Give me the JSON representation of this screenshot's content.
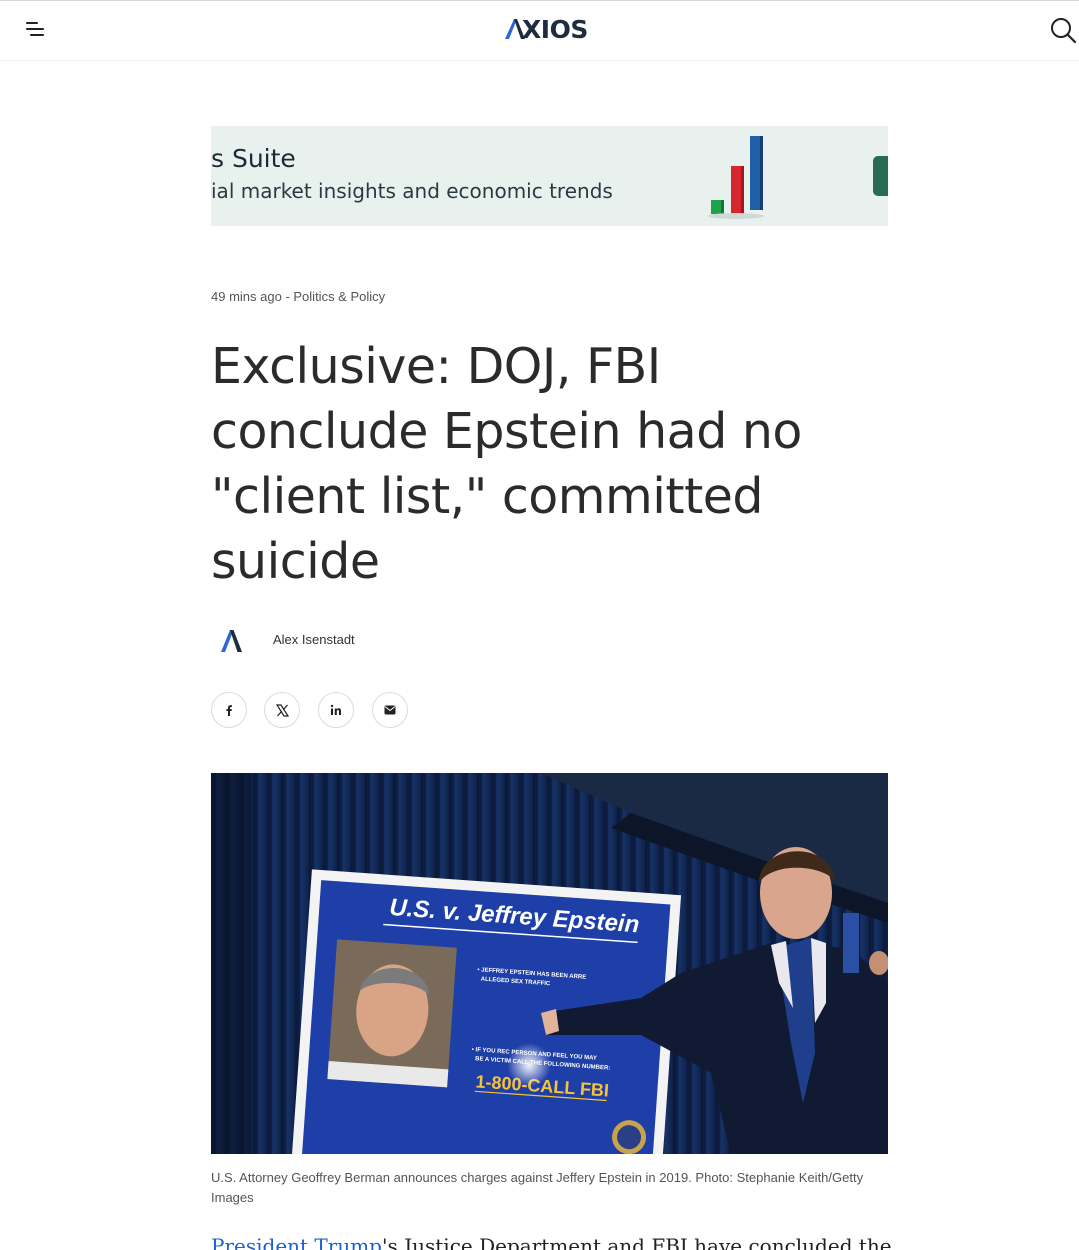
{
  "header": {
    "logo_text": "XIOS",
    "menu_icon": "menu-icon",
    "search_icon": "search-icon"
  },
  "ad": {
    "title": "s Suite",
    "subtitle": "ial market insights and economic trends",
    "colors": {
      "background": "#e9f1ee",
      "green": "#1fa24a",
      "red": "#d8262e",
      "blue": "#1e5fa8",
      "tab": "#2a6b55"
    }
  },
  "article": {
    "time": "49 mins ago",
    "separator": " - ",
    "category": "Politics & Policy",
    "headline": "Exclusive: DOJ, FBI conclude Epstein had no \"client list,\" committed suicide",
    "author": "Alex Isenstadt",
    "share": [
      {
        "name": "facebook",
        "icon": "facebook-icon"
      },
      {
        "name": "x",
        "icon": "x-icon"
      },
      {
        "name": "linkedin",
        "icon": "linkedin-icon"
      },
      {
        "name": "email",
        "icon": "email-icon"
      }
    ],
    "photo": {
      "sign_title": "U.S. v. Jeffrey Epstein",
      "bullet1": "JEFFREY EPSTEIN HAS BEEN ARRE... ALLEGED SEX TRAFFIC...",
      "bullet3": "IF YOU REC... PERSON AND FEEL YOU MAY BE A VICTIM ... CALL THE FOLLOWING NUMBER:",
      "phone": "1-800-CALL FBI"
    },
    "caption": "U.S. Attorney Geoffrey Berman announces charges against Jeffery Epstein in 2019. Photo: Stephanie Keith/Getty Images",
    "body_link": "President Trump",
    "body_rest": "'s Justice Department and FBI have concluded they have"
  },
  "colors": {
    "link": "#1b5fd6",
    "logo": "#1f2b3e",
    "avatar_blue": "#2b66d9"
  }
}
